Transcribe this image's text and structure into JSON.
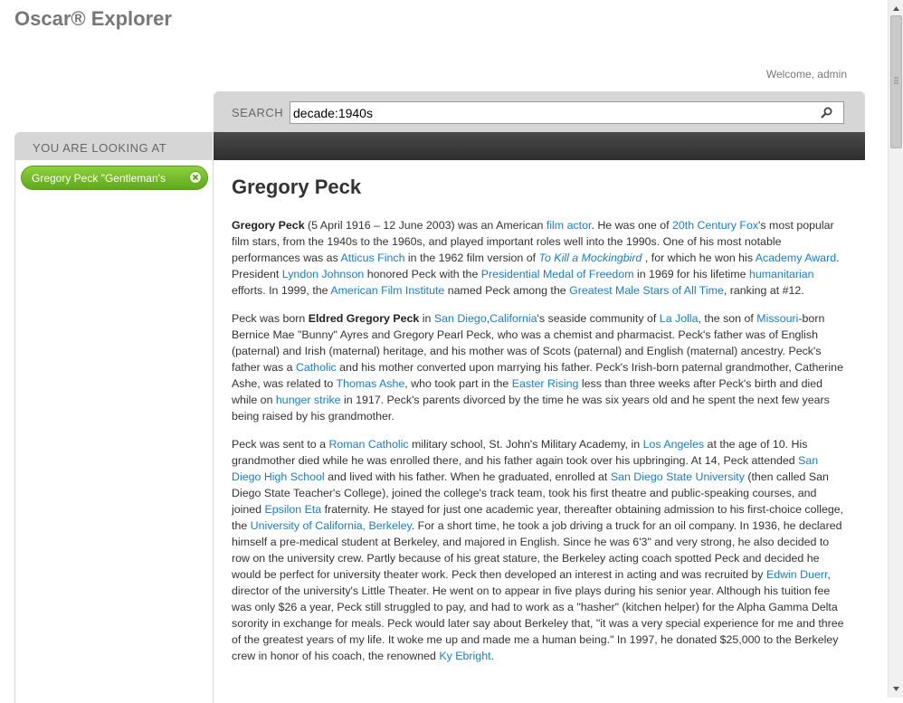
{
  "app": {
    "title": "Oscar® Explorer",
    "welcome": "Welcome, admin"
  },
  "search": {
    "label": "SEARCH",
    "value": "decade:1940s",
    "icon": "search-icon"
  },
  "sidebar": {
    "heading": "YOU ARE LOOKING AT",
    "tags": [
      {
        "label": "Gregory Peck \"Gentleman's",
        "remove_icon": "close-icon"
      }
    ]
  },
  "article": {
    "title": "Gregory Peck",
    "paragraphs": [
      [
        {
          "b": "Gregory Peck"
        },
        {
          "t": " (5 April 1916 – 12 June 2003) was an American "
        },
        {
          "a": "film actor"
        },
        {
          "t": ". He was one of "
        },
        {
          "a": "20th Century Fox"
        },
        {
          "t": "'s most popular film stars, from the 1940s to the 1960s, and played important roles well into the 1990s. One of his most notable performances was as "
        },
        {
          "a": "Atticus Finch"
        },
        {
          "t": " in the 1962 film version of "
        },
        {
          "ai": "To Kill a Mockingbird"
        },
        {
          "t": " , for which he won his "
        },
        {
          "a": "Academy Award"
        },
        {
          "t": ". President "
        },
        {
          "a": "Lyndon Johnson"
        },
        {
          "t": " honored Peck with the "
        },
        {
          "a": "Presidential Medal of Freedom"
        },
        {
          "t": " in 1969 for his lifetime "
        },
        {
          "a": "humanitarian"
        },
        {
          "t": " efforts. In 1999, the "
        },
        {
          "a": "American Film Institute"
        },
        {
          "t": " named Peck among the "
        },
        {
          "a": "Greatest Male Stars of All Time"
        },
        {
          "t": ", ranking at #12."
        }
      ],
      [
        {
          "t": "Peck was born "
        },
        {
          "b": "Eldred Gregory Peck"
        },
        {
          "t": " in "
        },
        {
          "a": "San Diego"
        },
        {
          "t": ","
        },
        {
          "a": "California"
        },
        {
          "t": "'s seaside community of "
        },
        {
          "a": "La Jolla"
        },
        {
          "t": ", the son of "
        },
        {
          "a": "Missouri"
        },
        {
          "t": "-born Bernice Mae \"Bunny\" Ayres and Gregory Pearl Peck, who was a chemist and pharmacist. Peck's father was of English (paternal) and Irish (maternal) heritage, and his mother was of Scots (paternal) and English (maternal) ancestry. Peck's father was a "
        },
        {
          "a": "Catholic"
        },
        {
          "t": " and his mother converted upon marrying his father. Peck's Irish-born paternal grandmother, Catherine Ashe, was related to "
        },
        {
          "a": "Thomas Ashe"
        },
        {
          "t": ", who took part in the "
        },
        {
          "a": "Easter Rising"
        },
        {
          "t": " less than three weeks after Peck's birth and died while on "
        },
        {
          "a": "hunger strike"
        },
        {
          "t": " in 1917. Peck's parents divorced by the time he was six years old and he spent the next few years being raised by his grandmother."
        }
      ],
      [
        {
          "t": "Peck was sent to a "
        },
        {
          "a": "Roman Catholic"
        },
        {
          "t": " military school, St. John's Military Academy, in "
        },
        {
          "a": "Los Angeles"
        },
        {
          "t": " at the age of 10. His grandmother died while he was enrolled there, and his father again took over his upbringing. At 14, Peck attended "
        },
        {
          "a": "San Diego High School"
        },
        {
          "t": " and lived with his father. When he graduated, enrolled at "
        },
        {
          "a": "San Diego State University"
        },
        {
          "t": " (then called San Diego State Teacher's College), joined the college's track team, took his first theatre and public-speaking courses, and joined "
        },
        {
          "a": "Epsilon Eta"
        },
        {
          "t": " fraternity. He stayed for just one academic year, thereafter obtaining admission to his first-choice college, the "
        },
        {
          "a": "University of California, Berkeley"
        },
        {
          "t": ". For a short time, he took a job driving a truck for an oil company. In 1936, he declared himself a pre-medical student at Berkeley, and majored in English. Since he was 6'3\" and very strong, he also decided to row on the university crew. Partly because of his great stature, the Berkeley acting coach spotted Peck and decided he would be perfect for university theater work. Peck then developed an interest in acting and was recruited by "
        },
        {
          "a": "Edwin Duerr"
        },
        {
          "t": ", director of the university's Little Theater. He went on to appear in five plays during his senior year. Although his tuition fee was only $26 a year, Peck still struggled to pay, and had to work as a \"hasher\" (kitchen helper) for the Alpha Gamma Delta sorority in exchange for meals. Peck would later say about Berkeley that, \"it was a very special experience for me and three of the greatest years of my life. It woke me up and made me a human being.\" In 1997, he donated $25,000 to the Berkeley crew in honor of his coach, the renowned "
        },
        {
          "a": "Ky Ebright"
        },
        {
          "t": "."
        }
      ]
    ]
  }
}
